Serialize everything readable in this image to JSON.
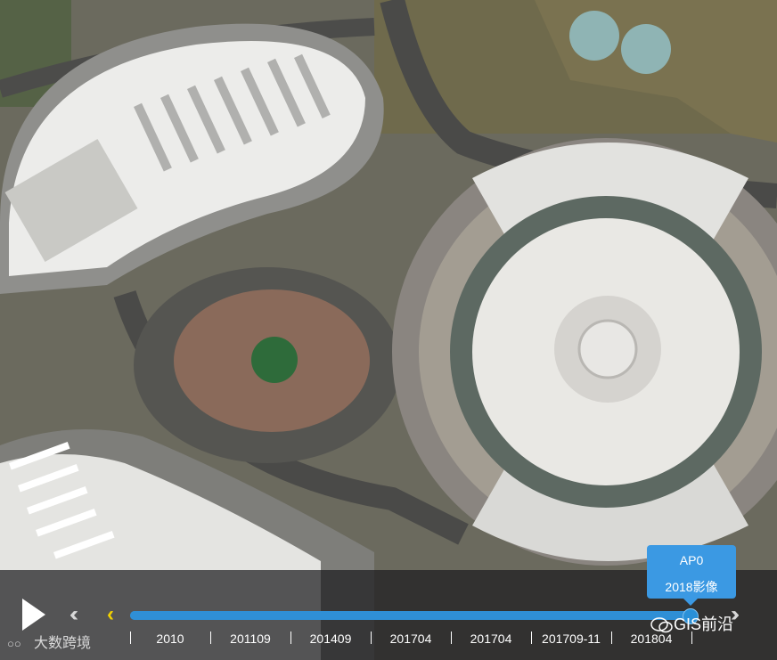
{
  "timeline": {
    "labels": [
      "2010",
      "201109",
      "201409",
      "201704",
      "201704",
      "201709-11",
      "201804"
    ],
    "selected_index": 7,
    "progress_percent": 100
  },
  "tooltip": {
    "line1": "AP0",
    "line2": "2018影像"
  },
  "watermark": {
    "left": "大数跨境",
    "right": "GIS前沿"
  },
  "icons": {
    "play": "play-icon",
    "double_left": "double-chevron-left-icon",
    "single_left": "chevron-left-icon",
    "double_right": "double-chevron-right-icon"
  },
  "colors": {
    "accent": "#2a90d8",
    "tooltip": "#3b99e3",
    "prev_arrow": "#f2d100"
  }
}
